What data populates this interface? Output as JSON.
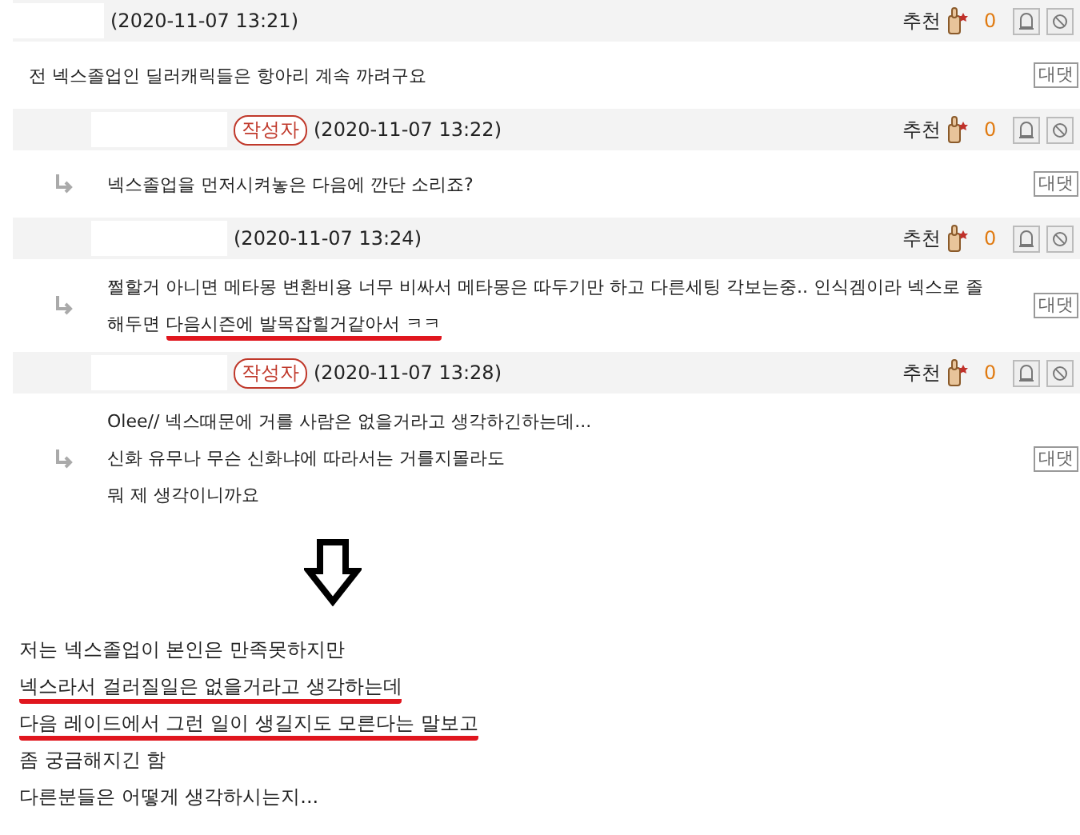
{
  "comments": [
    {
      "reply": false,
      "date": "(2020-11-07 13:21)",
      "recommend_label": "추천",
      "recommend_count": "0",
      "reply_button": "대댓",
      "lines": [
        [
          {
            "text": "전 넥스졸업인 딜러캐릭들은 항아리 계속 까려구요",
            "underlined": false
          }
        ]
      ]
    },
    {
      "reply": true,
      "author_badge": "작성자",
      "date": "(2020-11-07 13:22)",
      "recommend_label": "추천",
      "recommend_count": "0",
      "reply_button": "대댓",
      "lines": [
        [
          {
            "text": "넥스졸업을 먼저시켜놓은 다음에 깐단 소리죠?",
            "underlined": false
          }
        ]
      ]
    },
    {
      "reply": true,
      "date": "(2020-11-07 13:24)",
      "recommend_label": "추천",
      "recommend_count": "0",
      "reply_button": "대댓",
      "lines": [
        [
          {
            "text": "쩔할거 아니면 메타몽 변환비용 너무 비싸서 메타몽은 따두기만 하고 다른세팅 각보는중.. 인식겜이라 넥스로 졸",
            "underlined": false
          }
        ],
        [
          {
            "text": "해두면 ",
            "underlined": false
          },
          {
            "text": "다음시즌에 발목잡힐거같아서 ㅋㅋ",
            "underlined": true
          }
        ]
      ]
    },
    {
      "reply": true,
      "author_badge": "작성자",
      "date": "(2020-11-07 13:28)",
      "recommend_label": "추천",
      "recommend_count": "0",
      "reply_button": "대댓",
      "lines": [
        [
          {
            "text": "Olee// 넥스때문에 거를 사람은 없을거라고 생각하긴하는데...",
            "underlined": false
          }
        ],
        [
          {
            "text": "신화 유무나 무슨 신화냐에 따라서는 거를지몰라도",
            "underlined": false
          }
        ],
        [
          {
            "text": "뭐 제 생각이니까요",
            "underlined": false
          }
        ]
      ]
    }
  ],
  "post_lines": [
    {
      "text": "저는 넥스졸업이  본인은 만족못하지만",
      "underlined": false
    },
    {
      "text": "넥스라서 걸러질일은 없을거라고 생각하는데",
      "underlined": true
    },
    {
      "text": "다음 레이드에서 그런 일이 생길지도 모른다는 말보고",
      "underlined": true
    },
    {
      "text": "좀 궁금해지긴 함",
      "underlined": false
    },
    {
      "text": "다른분들은 어떻게 생각하시는지...",
      "underlined": false
    }
  ]
}
